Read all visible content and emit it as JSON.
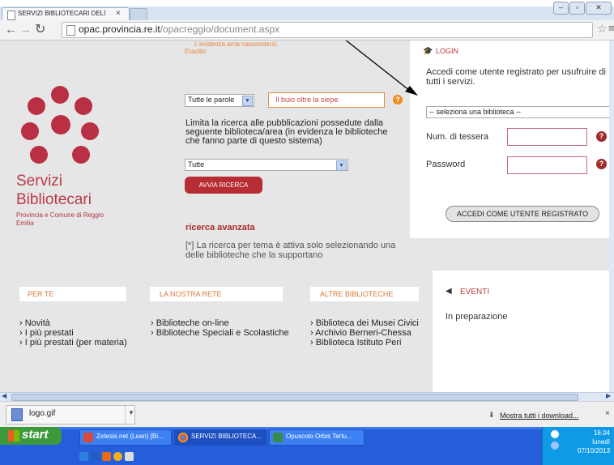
{
  "browser": {
    "tab_title": "SERVIZI BIBLIOTECARI DELİ",
    "tab_close": "×",
    "url_host": "opac.provincia.re.it",
    "url_path": "/opacreggio/document.aspx"
  },
  "page": {
    "quote": "L'evidenza ama nascondersi.",
    "quote_author": "Eraclito",
    "brand_line1": "Servizi",
    "brand_line2a": "Biblio",
    "brand_line2b": "tecari",
    "brand_sub": "Provincia e Comune di Reggio Emilia",
    "search_mode": "Tutte le parole",
    "search_value": "Il buio oltre la siepe",
    "limit_text": "Limita la ricerca alle pubblicazioni possedute dalla seguente biblioteca/area (in evidenza le biblioteche che fanno parte di questo sistema)",
    "library_select": "Tutte",
    "search_button": "AVVIA RICERCA",
    "advanced_search": "ricerca avanzata",
    "note": "[*] La ricerca per tema è attiva solo selezionando una delle biblioteche che la supportano"
  },
  "login": {
    "title": "LOGIN",
    "description": "Accedi come utente registrato per usufruire di tutti i servizi.",
    "library_placeholder": "-- seleziona una biblioteca --",
    "card_label": "Num. di tessera",
    "password_label": "Password",
    "submit": "ACCEDI COME UTENTE REGISTRATO",
    "help": "?"
  },
  "sections": [
    {
      "title": "PER TE",
      "items": [
        "› Novità",
        "› I più prestati",
        "› I più prestati (per materia)"
      ]
    },
    {
      "title": "LA NOSTRA RETE",
      "items": [
        "› Biblioteche on-line",
        "› Biblioteche Speciali e Scolastiche"
      ]
    },
    {
      "title": "ALTRE BIBLIOTECHE",
      "items": [
        "› Biblioteca dei Musei Civici",
        "› Archivio Berneri-Chessa",
        "› Biblioteca Istituto Peri"
      ]
    }
  ],
  "eventi": {
    "title": "EVENTI",
    "text": "In preparazione"
  },
  "downloads": {
    "file": "logo.gif",
    "show_all": "Mostra tutti i download..."
  },
  "taskbar": {
    "start": "start",
    "buttons": [
      "Zetesis.net (Loan) [Bi...",
      "SERVIZI BIBLIOTECA...",
      "Opuscolo Orbis Tertu..."
    ],
    "time": "16.04",
    "day": "lunedì",
    "date": "07/10/2013"
  }
}
